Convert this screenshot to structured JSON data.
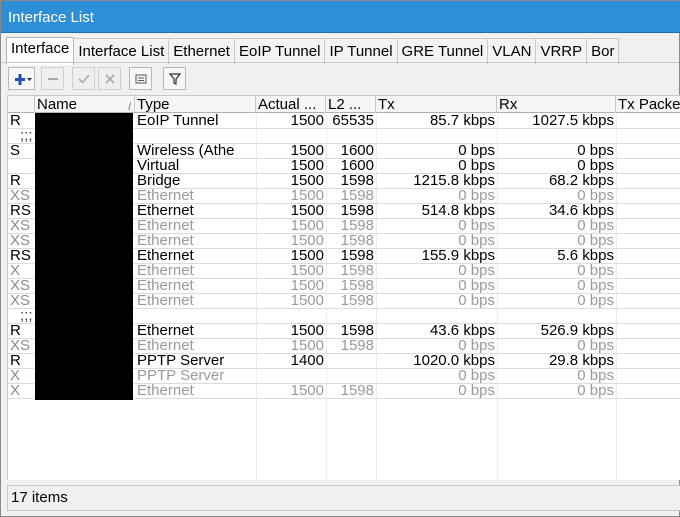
{
  "window": {
    "title": "Interface List"
  },
  "tabs": [
    {
      "label": "Interface",
      "active": true
    },
    {
      "label": "Interface List"
    },
    {
      "label": "Ethernet"
    },
    {
      "label": "EoIP Tunnel"
    },
    {
      "label": "IP Tunnel"
    },
    {
      "label": "GRE Tunnel"
    },
    {
      "label": "VLAN"
    },
    {
      "label": "VRRP"
    },
    {
      "label": "Bor"
    }
  ],
  "toolbar": {
    "add_icon": "plus-icon",
    "add_dropdown_icon": "caret-down-icon",
    "remove_icon": "minus-icon",
    "enable_icon": "check-icon",
    "disable_icon": "x-icon",
    "comment_icon": "note-icon",
    "filter_icon": "filter-icon",
    "accent_color": "#1f4fbf"
  },
  "table": {
    "columns": [
      "",
      "Name",
      "Type",
      "Actual ...",
      "L2 ...",
      "Tx",
      "Rx",
      "Tx Packe"
    ],
    "sort_indicator": "/",
    "rows": [
      {
        "flag": "R",
        "name": "",
        "type": "EoIP Tunnel",
        "mtu": "1500",
        "l2mtu": "65535",
        "tx": "85.7 kbps",
        "rx": "1027.5 kbps",
        "disabled": false
      },
      {
        "flag": ";;;",
        "name": "",
        "type": "",
        "mtu": "",
        "l2mtu": "",
        "tx": "",
        "rx": "",
        "disabled": false,
        "comment": true
      },
      {
        "flag": "S",
        "name": "",
        "type": "Wireless (Athe",
        "mtu": "1500",
        "l2mtu": "1600",
        "tx": "0 bps",
        "rx": "0 bps",
        "disabled": false
      },
      {
        "flag": "",
        "name": "",
        "type": "Virtual",
        "mtu": "1500",
        "l2mtu": "1600",
        "tx": "0 bps",
        "rx": "0 bps",
        "disabled": false
      },
      {
        "flag": "R",
        "name": "",
        "type": "Bridge",
        "mtu": "1500",
        "l2mtu": "1598",
        "tx": "1215.8 kbps",
        "rx": "68.2 kbps",
        "disabled": false
      },
      {
        "flag": "XS",
        "name": "",
        "type": "Ethernet",
        "mtu": "1500",
        "l2mtu": "1598",
        "tx": "0 bps",
        "rx": "0 bps",
        "disabled": true
      },
      {
        "flag": "RS",
        "name": "",
        "type": "Ethernet",
        "mtu": "1500",
        "l2mtu": "1598",
        "tx": "514.8 kbps",
        "rx": "34.6 kbps",
        "disabled": false
      },
      {
        "flag": "XS",
        "name": "",
        "type": "Ethernet",
        "mtu": "1500",
        "l2mtu": "1598",
        "tx": "0 bps",
        "rx": "0 bps",
        "disabled": true
      },
      {
        "flag": "XS",
        "name": "",
        "type": "Ethernet",
        "mtu": "1500",
        "l2mtu": "1598",
        "tx": "0 bps",
        "rx": "0 bps",
        "disabled": true
      },
      {
        "flag": "RS",
        "name": "",
        "type": "Ethernet",
        "mtu": "1500",
        "l2mtu": "1598",
        "tx": "155.9 kbps",
        "rx": "5.6 kbps",
        "disabled": false
      },
      {
        "flag": "X",
        "name": "",
        "type": "Ethernet",
        "mtu": "1500",
        "l2mtu": "1598",
        "tx": "0 bps",
        "rx": "0 bps",
        "disabled": true
      },
      {
        "flag": "XS",
        "name": "",
        "type": "Ethernet",
        "mtu": "1500",
        "l2mtu": "1598",
        "tx": "0 bps",
        "rx": "0 bps",
        "disabled": true
      },
      {
        "flag": "XS",
        "name": "",
        "type": "Ethernet",
        "mtu": "1500",
        "l2mtu": "1598",
        "tx": "0 bps",
        "rx": "0 bps",
        "disabled": true
      },
      {
        "flag": ";;;",
        "name": "",
        "type": "",
        "mtu": "",
        "l2mtu": "",
        "tx": "",
        "rx": "",
        "disabled": false,
        "comment": true
      },
      {
        "flag": "R",
        "name": "",
        "type": "Ethernet",
        "mtu": "1500",
        "l2mtu": "1598",
        "tx": "43.6 kbps",
        "rx": "526.9 kbps",
        "disabled": false
      },
      {
        "flag": "XS",
        "name": "",
        "type": "Ethernet",
        "mtu": "1500",
        "l2mtu": "1598",
        "tx": "0 bps",
        "rx": "0 bps",
        "disabled": true
      },
      {
        "flag": "R",
        "name": "",
        "type": "PPTP Server",
        "mtu": "1400",
        "l2mtu": "",
        "tx": "1020.0 kbps",
        "rx": "29.8 kbps",
        "disabled": false
      },
      {
        "flag": "X",
        "name": "",
        "type": "PPTP Server",
        "mtu": "",
        "l2mtu": "",
        "tx": "0 bps",
        "rx": "0 bps",
        "disabled": true
      },
      {
        "flag": "X",
        "name": "",
        "type": "Ethernet",
        "mtu": "1500",
        "l2mtu": "1598",
        "tx": "0 bps",
        "rx": "0 bps",
        "disabled": true
      }
    ]
  },
  "status": {
    "items_text": "17 items"
  }
}
